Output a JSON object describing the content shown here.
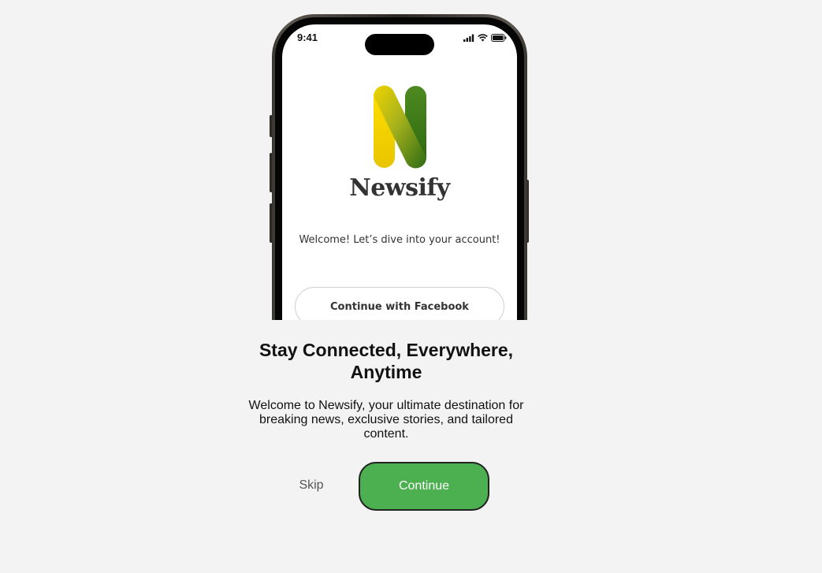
{
  "phone": {
    "status_time": "9:41",
    "brand_name": "Newsify",
    "welcome_text": "Welcome! Let’s dive into your account!",
    "facebook_button_label": "Continue with Facebook"
  },
  "onboarding": {
    "headline": "Stay Connected, Everywhere, Anytime",
    "description": "Welcome to Newsify, your ultimate destination for breaking news, exclusive stories, and tailored content.",
    "skip_label": "Skip",
    "continue_label": "Continue"
  },
  "colors": {
    "page_background": "#f3f3f3",
    "continue_button": "#4caf50",
    "logo_yellow": "#f2d200",
    "logo_green": "#2f6b14"
  },
  "icons": [
    "signal-icon",
    "wifi-icon",
    "battery-icon",
    "newsify-logo-icon"
  ]
}
